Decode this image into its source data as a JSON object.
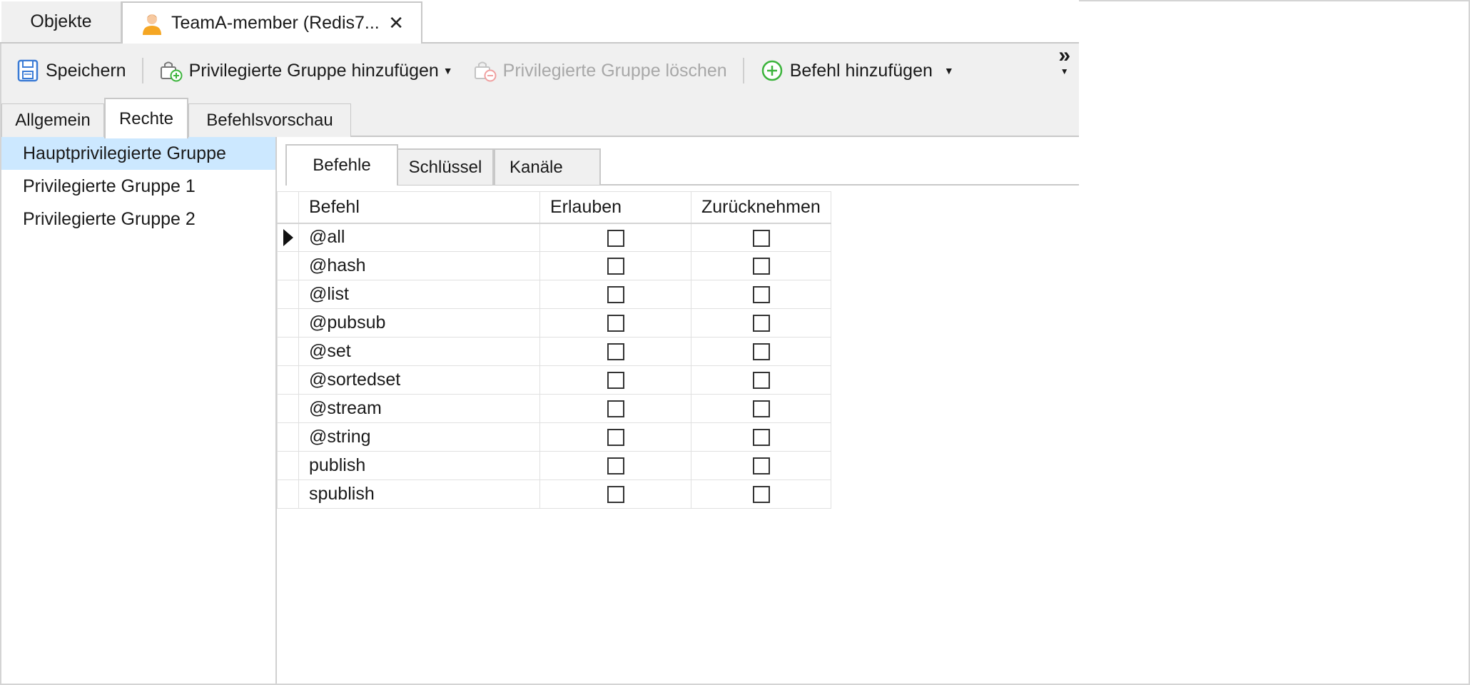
{
  "doc_tabs": [
    {
      "label": "Objekte"
    },
    {
      "label": "TeamA-member (Redis7...",
      "close": "✕"
    }
  ],
  "toolbar": {
    "save": "Speichern",
    "add_group": "Privilegierte Gruppe hinzufügen",
    "delete_group": "Privilegierte Gruppe löschen",
    "add_command": "Befehl hinzufügen",
    "overflow": "»"
  },
  "sub_tabs": [
    "Allgemein",
    "Rechte",
    "Befehlsvorschau"
  ],
  "groups": [
    "Hauptprivilegierte Gruppe",
    "Privilegierte Gruppe 1",
    "Privilegierte Gruppe 2"
  ],
  "inner_tabs": [
    "Befehle",
    "Schlüssel",
    "Kanäle"
  ],
  "table": {
    "headers": [
      "Befehl",
      "Erlauben",
      "Zurücknehmen"
    ],
    "rows": [
      "@all",
      "@hash",
      "@list",
      "@pubsub",
      "@set",
      "@sortedset",
      "@stream",
      "@string",
      "publish",
      "spublish"
    ]
  },
  "colors": {
    "selection": "#cce8ff",
    "toolbar_bg": "#f0f0f0",
    "add_green": "#3cb43c"
  }
}
